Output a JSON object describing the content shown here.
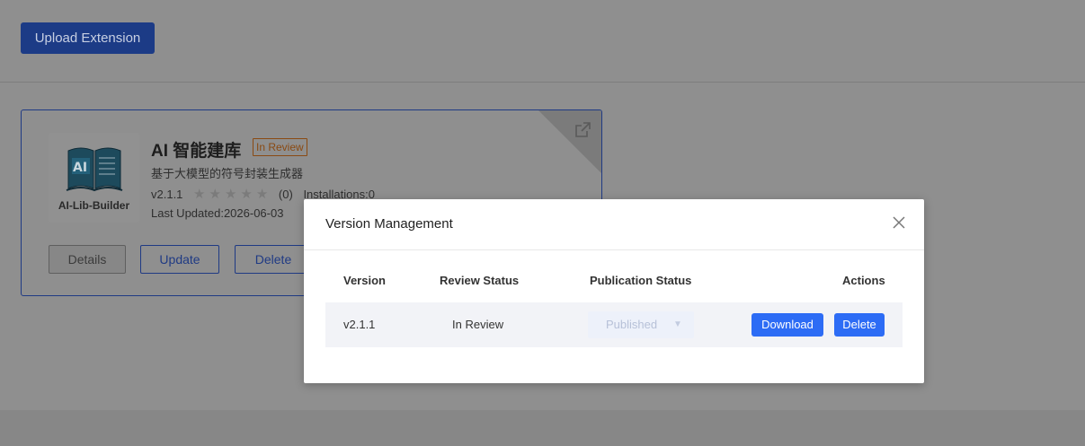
{
  "toolbar": {
    "upload_label": "Upload Extension"
  },
  "card": {
    "logo_text": "AI-Lib-Builder",
    "title": "AI 智能建库",
    "status_badge": "In Review",
    "subtitle": "基于大模型的符号封装生成器",
    "version": "v2.1.1",
    "stars_glyphs": "★★★★★",
    "rating_count": "(0)",
    "installations": "Installations:0",
    "last_updated": "Last Updated:2026-06-03",
    "details_label": "Details",
    "update_label": "Update",
    "delete_label": "Delete"
  },
  "modal": {
    "title": "Version Management",
    "columns": [
      "Version",
      "Review Status",
      "Publication Status",
      "Actions"
    ],
    "rows": [
      {
        "version": "v2.1.1",
        "review_status": "In Review",
        "publication_status": "Published",
        "download_label": "Download",
        "delete_label": "Delete"
      }
    ]
  },
  "colors": {
    "overlay_bg": "#8f8f8f",
    "primary": "#2d6cf5",
    "badge_orange": "#8a4a12"
  }
}
